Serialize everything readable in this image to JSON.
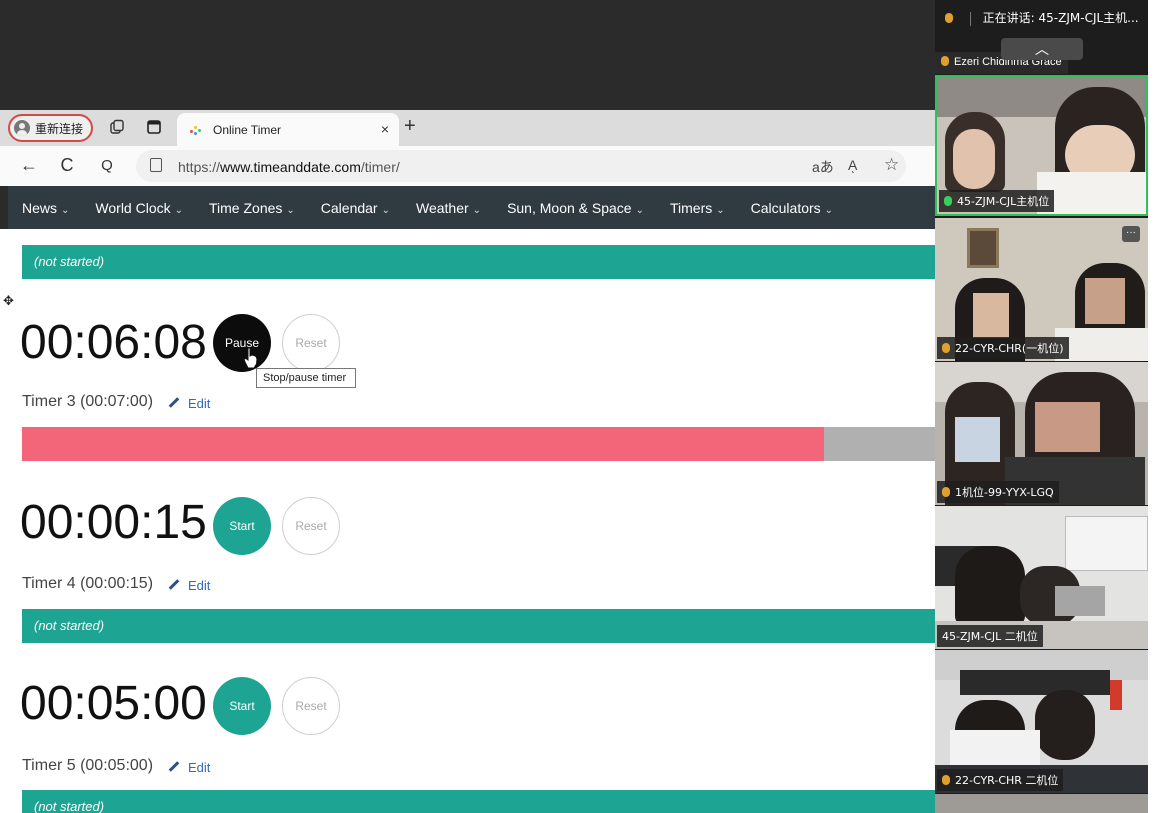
{
  "browser": {
    "profile_label": "重新连接",
    "tab_title": "Online Timer",
    "tab_close": "×",
    "new_tab": "+",
    "url_prefix": "https://",
    "url_domain": "www.timeanddate.com",
    "url_path": "/timer/",
    "nav_back": "←",
    "nav_refresh": "C",
    "nav_search": "Q",
    "read_aloud": "aあ",
    "text_size": "Aͅ",
    "favorite": "☆"
  },
  "site_nav": {
    "items": [
      {
        "label": "News"
      },
      {
        "label": "World Clock"
      },
      {
        "label": "Time Zones"
      },
      {
        "label": "Calendar"
      },
      {
        "label": "Weather"
      },
      {
        "label": "Sun, Moon & Space"
      },
      {
        "label": "Timers"
      },
      {
        "label": "Calculators"
      }
    ],
    "chevron": "⌄"
  },
  "timers": {
    "top_status": "(not started)",
    "t3": {
      "time": "00:06:08",
      "primary_label": "Pause",
      "reset_label": "Reset",
      "name": "Timer 3 (00:07:00)",
      "edit_label": "Edit",
      "progress": 0.878,
      "tooltip": "Stop/pause timer"
    },
    "t4": {
      "time": "00:00:15",
      "primary_label": "Start",
      "reset_label": "Reset",
      "name": "Timer 4 (00:00:15)",
      "edit_label": "Edit",
      "status": "(not started)"
    },
    "t5": {
      "time": "00:05:00",
      "primary_label": "Start",
      "reset_label": "Reset",
      "name": "Timer 5 (00:05:00)",
      "edit_label": "Edit",
      "status": "(not started)"
    }
  },
  "meeting": {
    "speaking_label": "正在讲话:",
    "speaking_name": "45-ZJM-CJL主机...",
    "top_participant": "Ezeri Chidinma Grace",
    "collapse_icon": "︿",
    "more_icon": "···",
    "tiles": [
      {
        "name": "45-ZJM-CJL主机位"
      },
      {
        "name": "22-CYR-CHR(一机位)"
      },
      {
        "name": "1机位-99-YYX-LGQ"
      },
      {
        "name": "45-ZJM-CJL 二机位"
      },
      {
        "name": "22-CYR-CHR 二机位"
      }
    ]
  },
  "colors": {
    "teal": "#1ea493",
    "pink": "#f3667a",
    "nav_bg": "#2f3a41",
    "active_border": "#2fc05a"
  }
}
